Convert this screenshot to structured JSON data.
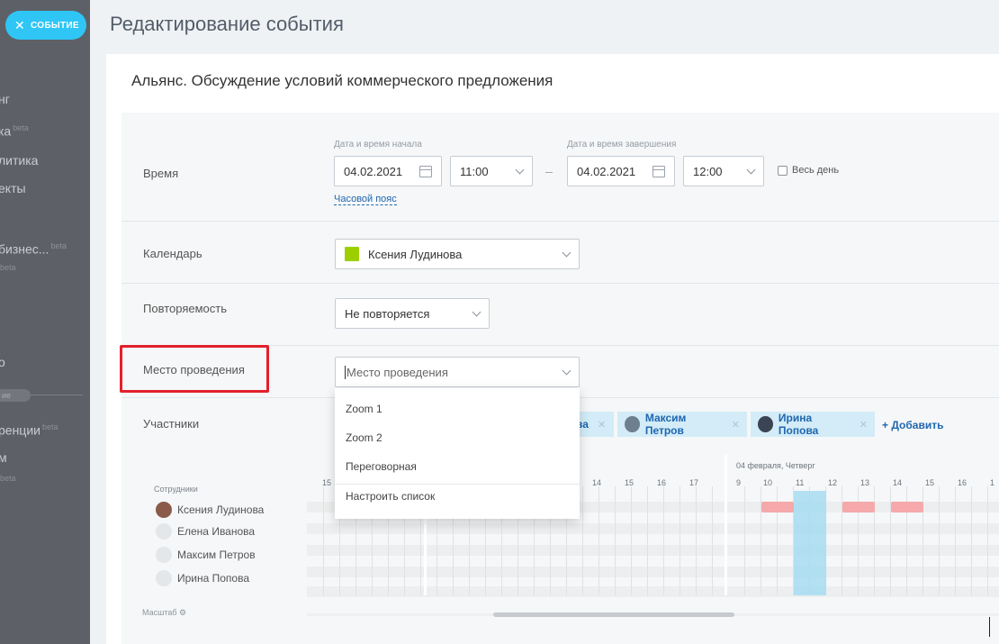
{
  "sidebar": {
    "event_button": "СОБЫТИЕ",
    "items": [
      {
        "label": "нг",
        "badge": ""
      },
      {
        "label": "ка",
        "badge": "beta"
      },
      {
        "label": "литика",
        "badge": ""
      },
      {
        "label": "екты",
        "badge": ""
      },
      {
        "label": "бизнес...",
        "badge": "beta"
      },
      {
        "label": "",
        "badge": "beta"
      },
      {
        "label": "о",
        "badge": ""
      },
      {
        "label": "ренции",
        "badge": "beta"
      },
      {
        "label": "м",
        "badge": ""
      },
      {
        "label": "",
        "badge": "beta"
      }
    ],
    "pill": "ие"
  },
  "header": {
    "title": "Редактирование события"
  },
  "event": {
    "name": "Альянс. Обсуждение условий коммерческого предложения"
  },
  "time": {
    "label": "Время",
    "start_caption": "Дата и время начала",
    "end_caption": "Дата и время завершения",
    "start_date": "04.02.2021",
    "start_time": "11:00",
    "end_date": "04.02.2021",
    "end_time": "12:00",
    "all_day": "Весь день",
    "timezone_link": "Часовой пояс"
  },
  "calendar": {
    "label": "Календарь",
    "value": "Ксения Лудинова",
    "color": "#9dcf00"
  },
  "repeat": {
    "label": "Повторяемость",
    "value": "Не повторяется"
  },
  "location": {
    "label": "Место проведения",
    "placeholder": "Место проведения",
    "options": [
      "Zoom 1",
      "Zoom 2",
      "Переговорная"
    ],
    "configure": "Настроить список"
  },
  "participants": {
    "label": "Участники",
    "chips": [
      {
        "name": "ва"
      },
      {
        "name": "Максим Петров"
      },
      {
        "name": "Ирина Попова"
      }
    ],
    "add": "+ Добавить"
  },
  "planner": {
    "employees_header": "Сотрудники",
    "employees": [
      "Ксения Лудинова",
      "Елена Иванова",
      "Максим Петров",
      "Ирина Попова"
    ],
    "day_label": "04 февраля, Четверг",
    "hours_left": [
      "15"
    ],
    "hours_mid": [
      "14",
      "15",
      "16",
      "17"
    ],
    "hours_right": [
      "9",
      "10",
      "11",
      "12",
      "13",
      "14",
      "15",
      "16",
      "1"
    ],
    "scale_label": "Масштаб"
  }
}
